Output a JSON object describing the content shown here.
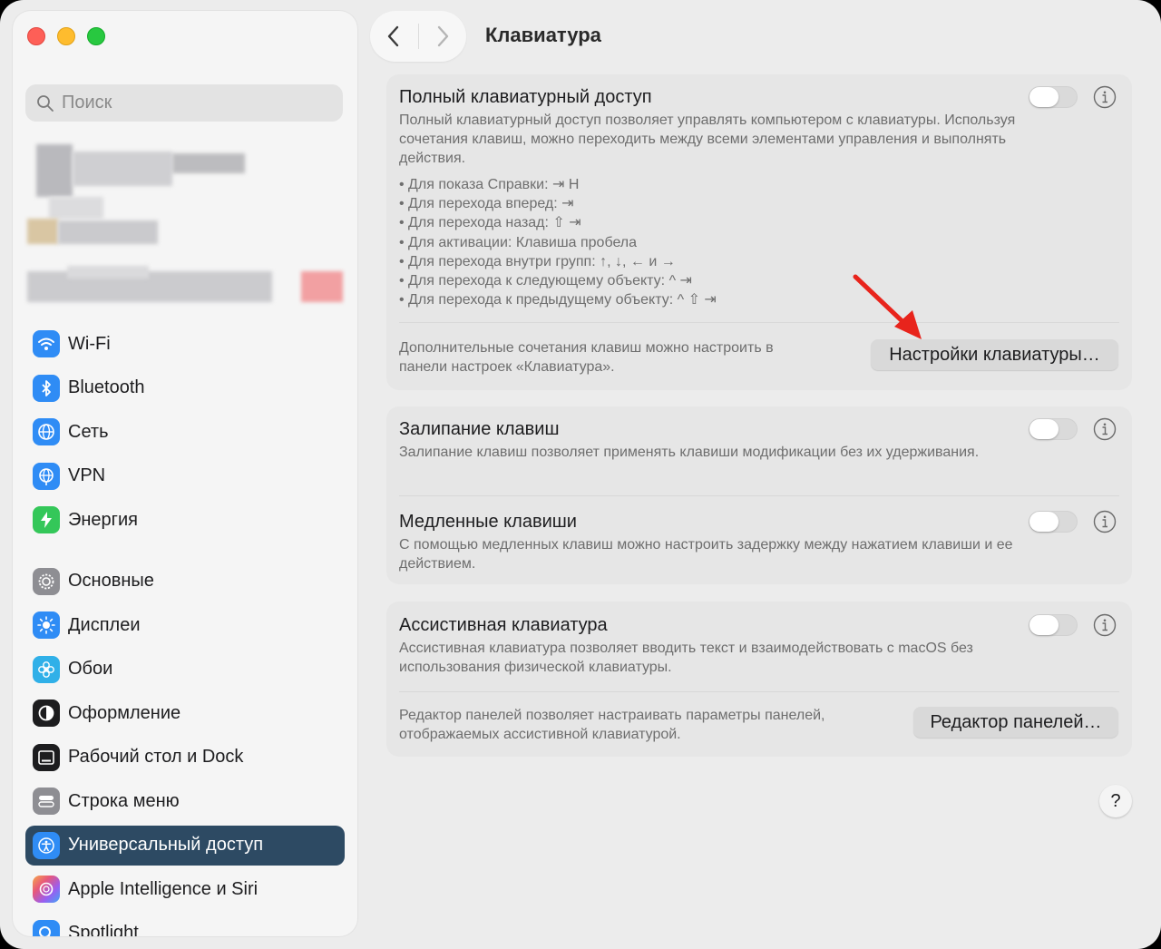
{
  "window": {
    "title": "Клавиатура"
  },
  "sidebar": {
    "search_placeholder": "Поиск",
    "items": [
      {
        "label": "Wi-Fi",
        "icon": "wifi-icon",
        "color": "#2f8cf5"
      },
      {
        "label": "Bluetooth",
        "icon": "bluetooth-icon",
        "color": "#2f8cf5"
      },
      {
        "label": "Сеть",
        "icon": "globe-icon",
        "color": "#2f8cf5"
      },
      {
        "label": "VPN",
        "icon": "vpn-globe-icon",
        "color": "#2f8cf5"
      },
      {
        "label": "Энергия",
        "icon": "lightning-icon",
        "color": "#34c759"
      },
      {
        "label": "Основные",
        "icon": "gear-icon",
        "color": "#8e8e93"
      },
      {
        "label": "Дисплеи",
        "icon": "sun-icon",
        "color": "#2f8cf5"
      },
      {
        "label": "Обои",
        "icon": "flower-icon",
        "color": "#30b0e8"
      },
      {
        "label": "Оформление",
        "icon": "appearance-icon",
        "color": "#1d1d1f"
      },
      {
        "label": "Рабочий стол и Dock",
        "icon": "desktop-dock-icon",
        "color": "#1d1d1f"
      },
      {
        "label": "Строка меню",
        "icon": "menubar-icon",
        "color": "#8e8e93"
      },
      {
        "label": "Универсальный доступ",
        "icon": "accessibility-icon",
        "color": "#2f8cf5",
        "selected": true
      },
      {
        "label": "Apple Intelligence и Siri",
        "icon": "siri-icon",
        "color": "#e7577a"
      },
      {
        "label": "Spotlight",
        "icon": "spotlight-icon",
        "color": "#2f8cf5"
      }
    ]
  },
  "main": {
    "full_access": {
      "title": "Полный клавиатурный доступ",
      "description": "Полный клавиатурный доступ позволяет управлять компьютером с клавиатуры. Используя сочетания клавиш, можно переходить между всеми элементами управления и выполнять действия.",
      "bullets": [
        "• Для показа Справки: ⇥ H",
        "• Для перехода вперед: ⇥",
        "• Для перехода назад: ⇧ ⇥",
        "• Для активации: Клавиша пробела",
        "• Для перехода внутри групп: ↑, ↓, ← и →",
        "• Для перехода к следующему объекту: ^ ⇥",
        "• Для перехода к предыдущему объекту: ^ ⇧ ⇥"
      ],
      "extra_text": "Дополнительные сочетания клавиш можно настроить в панели настроек «Клавиатура».",
      "button": "Настройки клавиатуры…",
      "enabled": false
    },
    "sticky_keys": {
      "title": "Залипание клавиш",
      "description": "Залипание клавиш позволяет применять клавиши модификации без их удерживания.",
      "enabled": false
    },
    "slow_keys": {
      "title": "Медленные клавиши",
      "description": "С помощью медленных клавиш можно настроить задержку между нажатием клавиши и ее действием.",
      "enabled": false
    },
    "assistive_keyboard": {
      "title": "Ассистивная клавиатура",
      "description": "Ассистивная клавиатура позволяет вводить текст и взаимодействовать с macOS без использования физической клавиатуры.",
      "panel_text": "Редактор панелей позволяет настраивать параметры панелей, отображаемых ассистивной клавиатурой.",
      "button": "Редактор панелей…",
      "enabled": false
    },
    "help_label": "?"
  },
  "colors": {
    "selected_sidebar": "#2d4a63",
    "annotation_arrow": "#e8241c"
  }
}
